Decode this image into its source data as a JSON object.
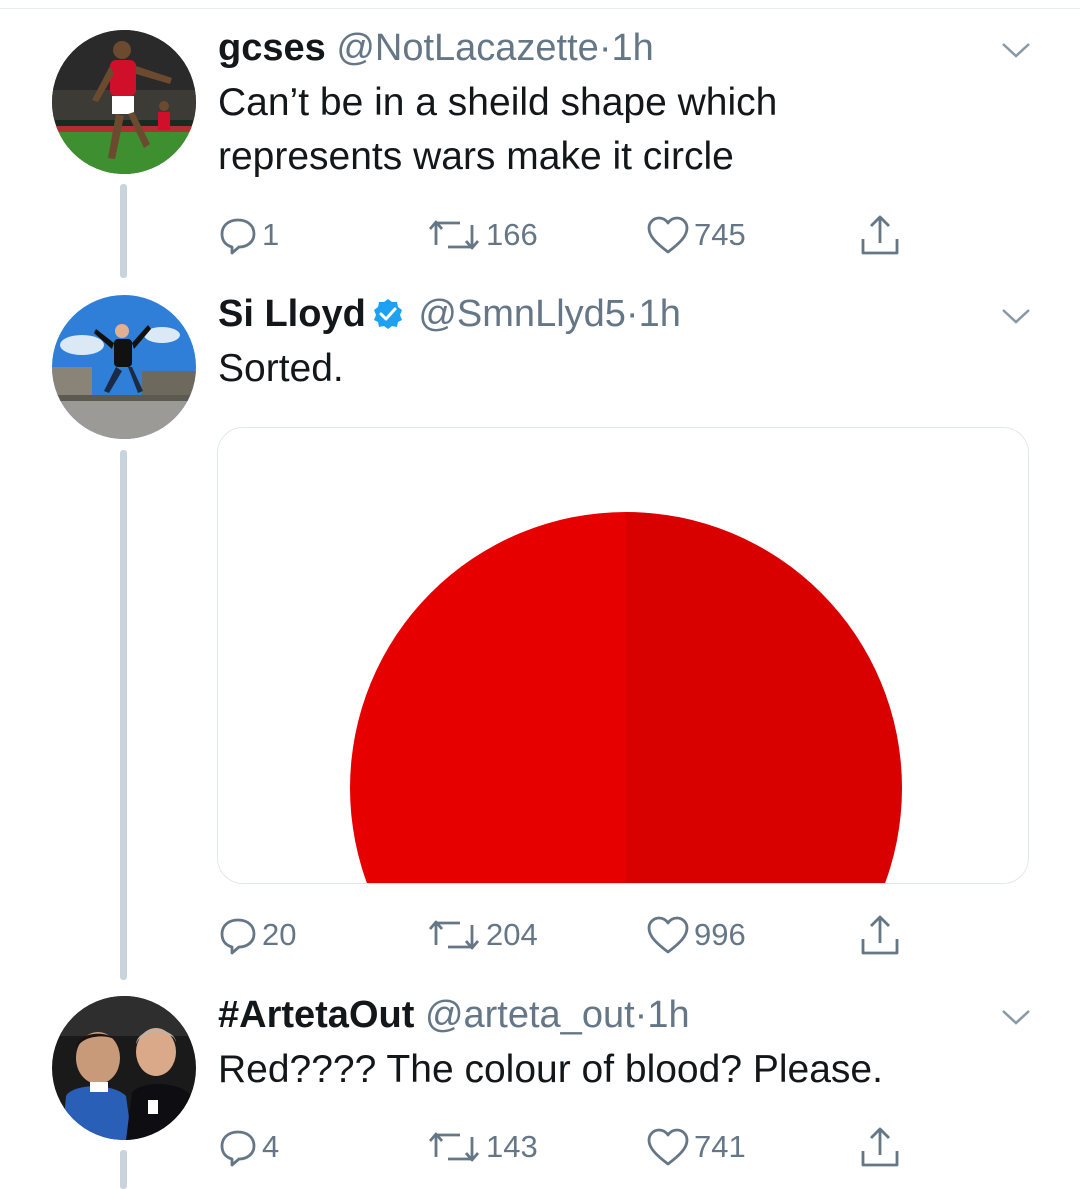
{
  "tweets": [
    {
      "name": "gcses",
      "handle": "@NotLacazette",
      "time": "1h",
      "text_lines": [
        "Can’t be in a sheild shape which",
        "represents wars make it circle"
      ],
      "replies": "1",
      "retweets": "166",
      "likes": "745"
    },
    {
      "name": "Si Lloyd",
      "verified": true,
      "handle": "@SmnLlyd5",
      "time": "1h",
      "text_lines": [
        "Sorted."
      ],
      "replies": "20",
      "retweets": "204",
      "likes": "996"
    },
    {
      "name": "#ArtetaOut",
      "handle": "@arteta_out",
      "time": "1h",
      "text_lines": [
        "Red???? The colour of blood? Please."
      ],
      "replies": "4",
      "retweets": "143",
      "likes": "741"
    }
  ],
  "separator": "·",
  "colors": {
    "text": "#14171a",
    "secondary": "#657786",
    "verified": "#1da1f2",
    "thread_line": "#c9d3dc",
    "circle_left": "#e60000",
    "circle_right": "#d90000"
  },
  "icons": [
    "reply-icon",
    "retweet-icon",
    "like-icon",
    "share-icon",
    "chevron-down-icon",
    "verified-badge-icon"
  ]
}
